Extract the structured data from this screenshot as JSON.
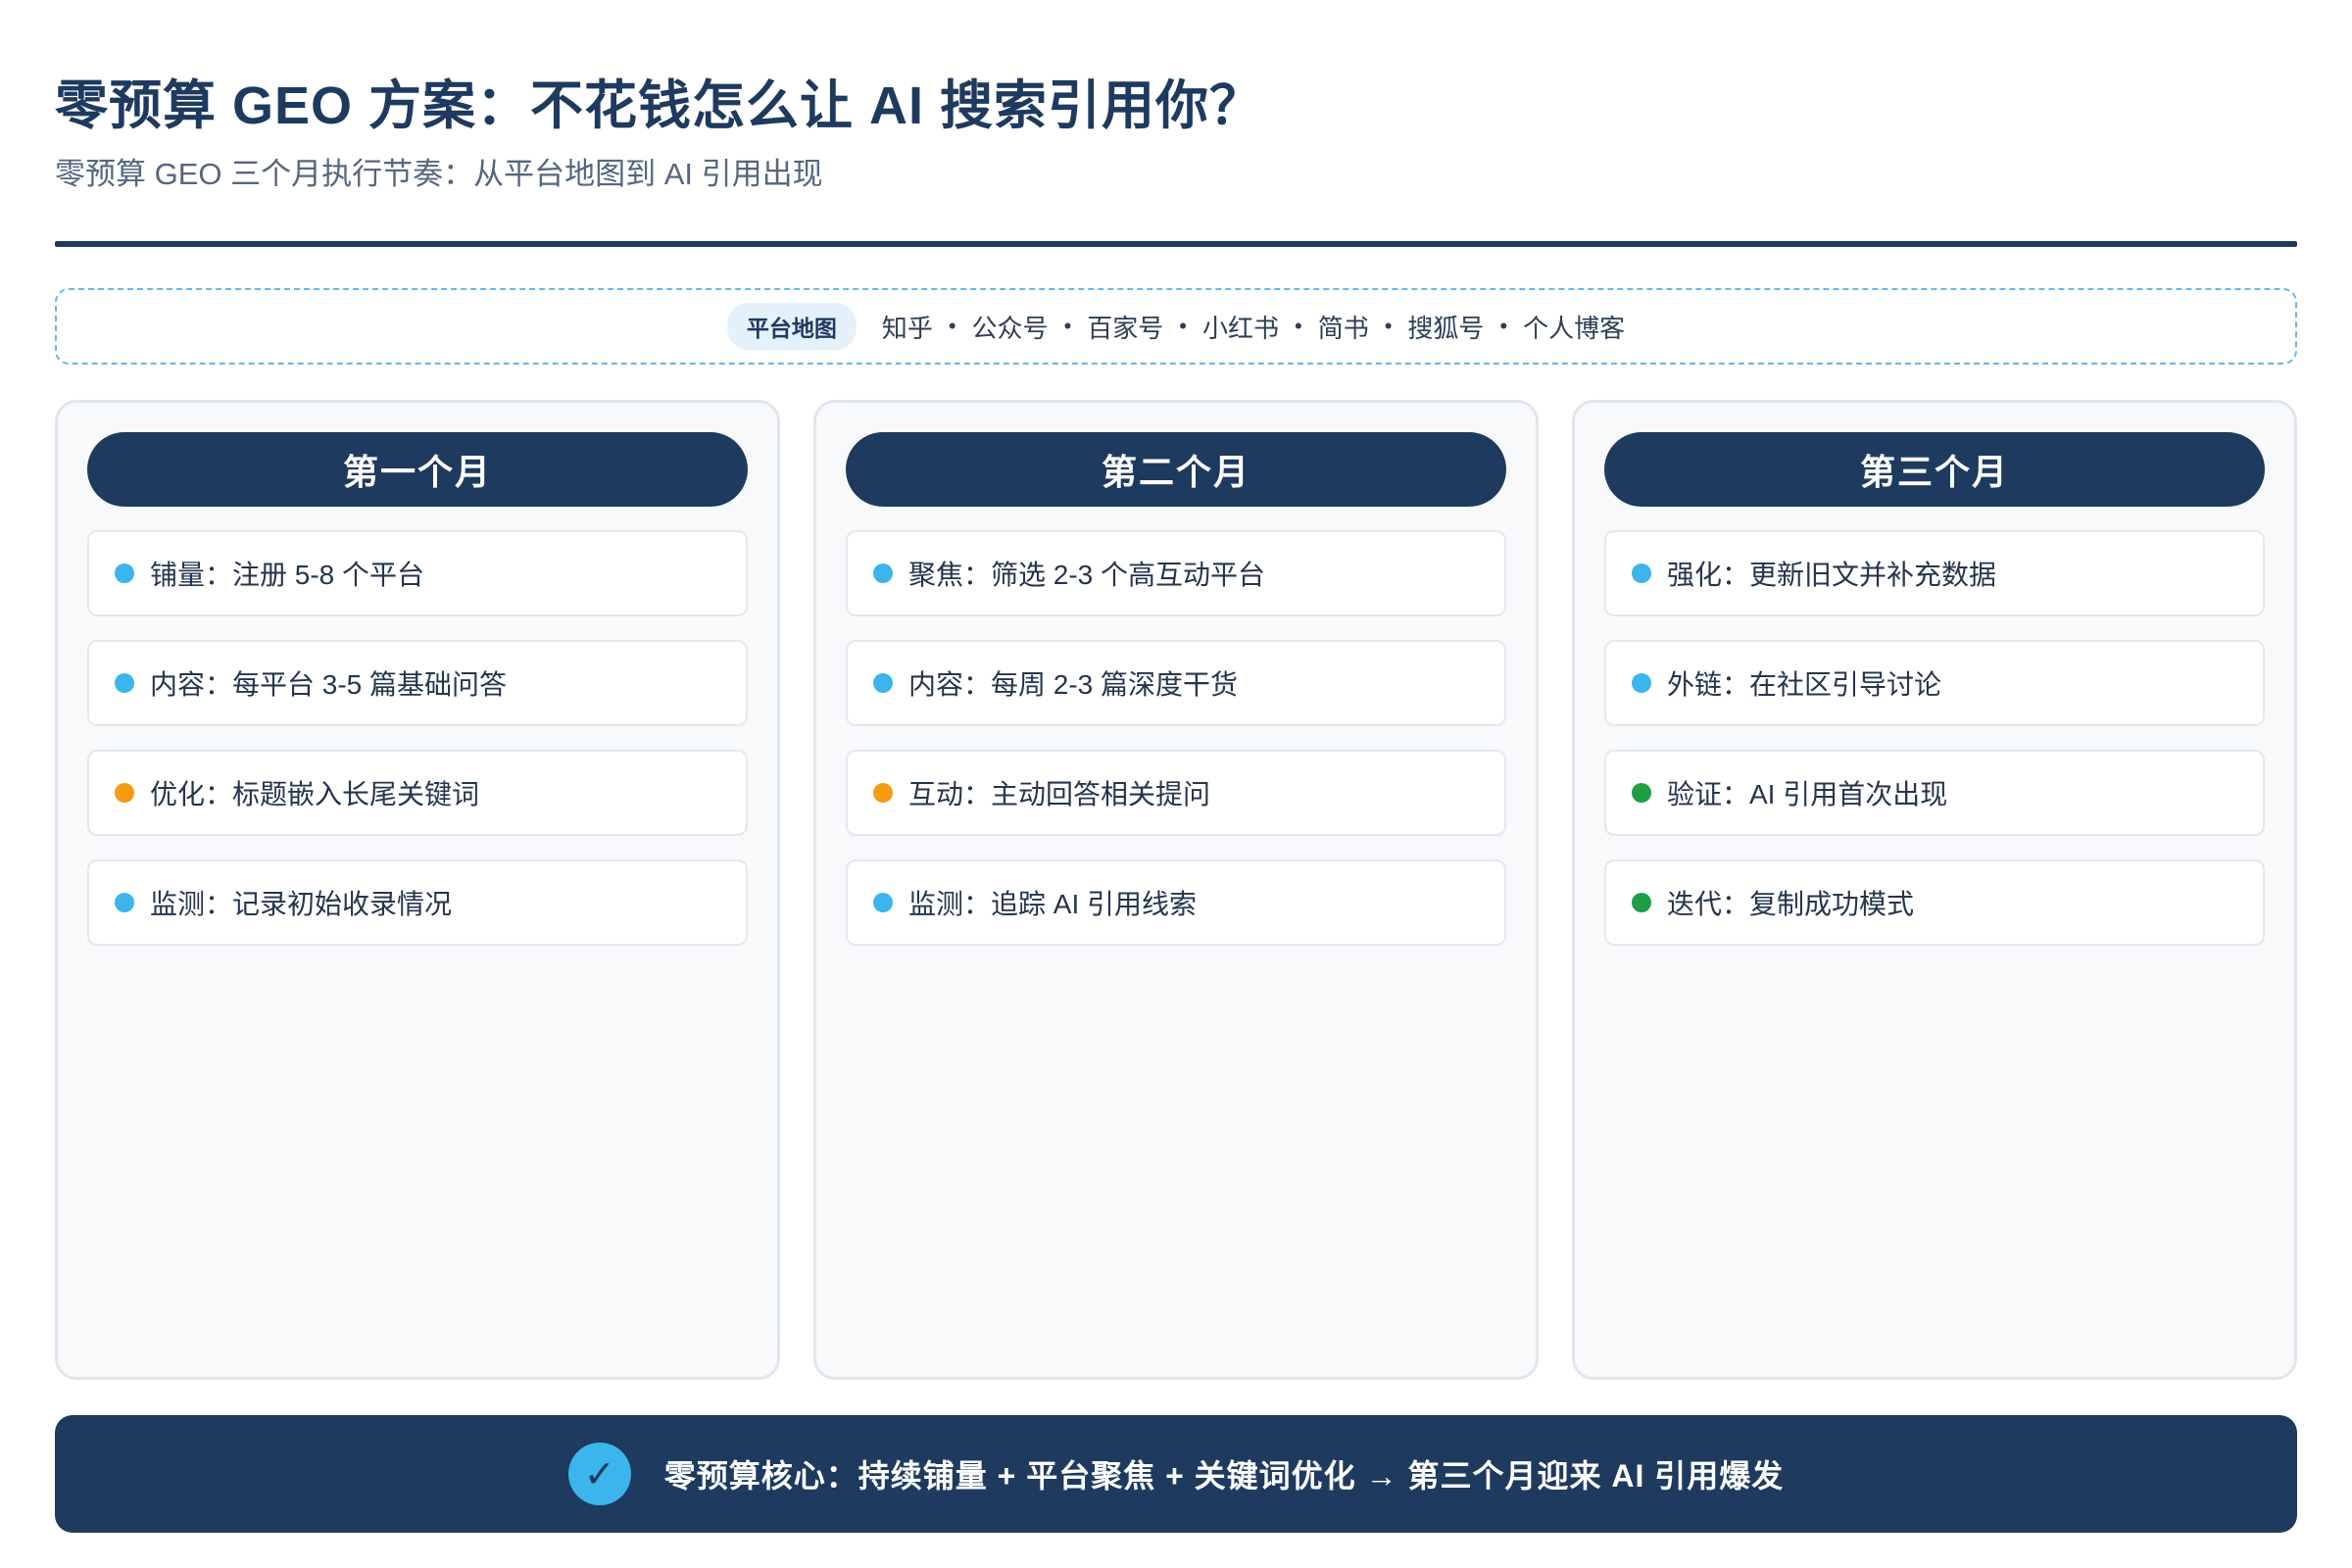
{
  "header": {
    "title": "零预算 GEO 方案：不花钱怎么让 AI 搜索引用你？",
    "subtitle": "零预算 GEO 三个月执行节奏：从平台地图到 AI 引用出现"
  },
  "platform_map": {
    "tag": "平台地图",
    "separator": "•",
    "items": [
      "知乎",
      "公众号",
      "百家号",
      "小红书",
      "简书",
      "搜狐号",
      "个人博客"
    ]
  },
  "colors": {
    "navy": "#1e3a5f",
    "blue_dot": "#3bb5ec",
    "orange_dot": "#f39c12",
    "green_dot": "#1e9e45"
  },
  "months": [
    {
      "label": "第一个月",
      "tasks": [
        {
          "text": "铺量：注册 5-8 个平台",
          "dot": "#3bb5ec"
        },
        {
          "text": "内容：每平台 3-5 篇基础问答",
          "dot": "#3bb5ec"
        },
        {
          "text": "优化：标题嵌入长尾关键词",
          "dot": "#f39c12"
        },
        {
          "text": "监测：记录初始收录情况",
          "dot": "#3bb5ec"
        }
      ]
    },
    {
      "label": "第二个月",
      "tasks": [
        {
          "text": "聚焦：筛选 2-3 个高互动平台",
          "dot": "#3bb5ec"
        },
        {
          "text": "内容：每周 2-3 篇深度干货",
          "dot": "#3bb5ec"
        },
        {
          "text": "互动：主动回答相关提问",
          "dot": "#f39c12"
        },
        {
          "text": "监测：追踪 AI 引用线索",
          "dot": "#3bb5ec"
        }
      ]
    },
    {
      "label": "第三个月",
      "tasks": [
        {
          "text": "强化：更新旧文并补充数据",
          "dot": "#3bb5ec"
        },
        {
          "text": "外链：在社区引导讨论",
          "dot": "#3bb5ec"
        },
        {
          "text": "验证：AI 引用首次出现",
          "dot": "#1e9e45"
        },
        {
          "text": "迭代：复制成功模式",
          "dot": "#1e9e45"
        }
      ]
    }
  ],
  "footer": {
    "icon": "check-icon",
    "icon_glyph": "✓",
    "text": "零预算核心：持续铺量 + 平台聚焦 + 关键词优化 → 第三个月迎来 AI 引用爆发"
  }
}
